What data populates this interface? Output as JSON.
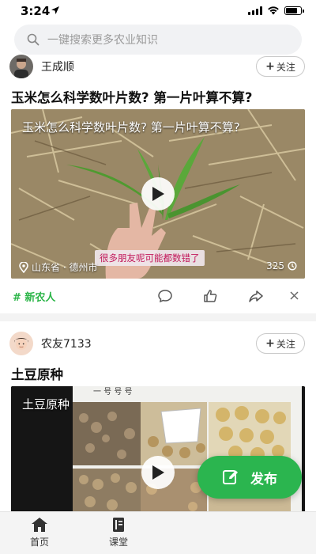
{
  "status_bar": {
    "time": "3:24"
  },
  "search": {
    "placeholder": "一键搜索更多农业知识"
  },
  "posts": [
    {
      "author": "王成顺",
      "follow_label": "关注",
      "title": "玉米怎么科学数叶片数? 第一片叶算不算?",
      "video_title": "玉米怎么科学数叶片数? 第一片叶算不算?",
      "subtitle": "很多朋友呢可能都数错了",
      "location": "山东省 · 德州市",
      "views": "325",
      "tag": "新农人"
    },
    {
      "author": "农友7133",
      "follow_label": "关注",
      "title": "土豆原种",
      "video_title": "土豆原种",
      "video_top_text": "一 号 号 号"
    }
  ],
  "publish": {
    "label": "发布"
  },
  "nav": {
    "items": [
      {
        "label": "首页"
      },
      {
        "label": "课堂"
      }
    ]
  },
  "colors": {
    "accent_green": "#2bb54f",
    "tag_green": "#2bb548",
    "subtitle_pink": "#c2185b"
  }
}
